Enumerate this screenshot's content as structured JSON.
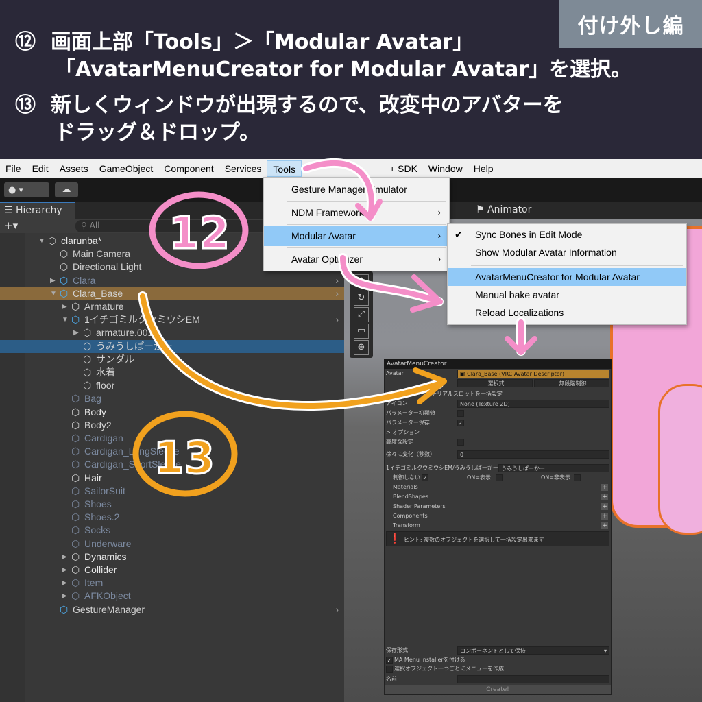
{
  "banner": {
    "badge": "付け外し編",
    "step12": {
      "num": "⑫",
      "line1": "画面上部「Tools」＞「Modular Avatar」",
      "line2": "「AvatarMenuCreator for Modular Avatar」を選択。"
    },
    "step13": {
      "num": "⑬",
      "line1": "新しくウィンドウが出現するので、改変中のアバターを",
      "line2": "ドラッグ＆ドロップ。"
    }
  },
  "menubar": [
    "File",
    "Edit",
    "Assets",
    "GameObject",
    "Component",
    "Services",
    "Tools",
    "",
    "+ SDK",
    "Window",
    "Help"
  ],
  "tools_menu": [
    "Gesture Manager Emulator",
    "NDM Framework",
    "Modular Avatar",
    "Avatar Optimizer"
  ],
  "ma_submenu": [
    "Sync Bones in Edit Mode",
    "Show Modular Avatar Information",
    "AvatarMenuCreator for Modular Avatar",
    "Manual bake avatar",
    "Reload Localizations"
  ],
  "hierarchy": {
    "tab": "Hierarchy",
    "search_placeholder": "All",
    "rows": [
      "clarunba*",
      "Main Camera",
      "Directional Light",
      "Clara",
      "Clara_Base",
      "Armature",
      "1イチゴミルクウミウシEM",
      "armature.001",
      "うみうしぱーかー",
      "サンダル",
      "水着",
      "floor",
      "Bag",
      "Body",
      "Body2",
      "Cardigan",
      "Cardigan_LongSleeve",
      "Cardigan_ShortSleeve",
      "Hair",
      "SailorSuit",
      "Shoes",
      "Shoes.2",
      "Socks",
      "Underware",
      "Dynamics",
      "Collider",
      "Item",
      "AFKObject",
      "GestureManager"
    ]
  },
  "scene": {
    "animator_tab": "Animator"
  },
  "amc": {
    "title": "AvatarMenuCreator",
    "avatar_label": "Avatar",
    "avatar_value": "Clara_Base (VRC Avatar Descriptor)",
    "mode_select": "選択式",
    "mode_unlimited": "無段階制御",
    "material_slot": "マテリアルスロットを一括設定",
    "icon_label": "アイコン",
    "icon_value": "None (Texture 2D)",
    "param_default": "パラメーター初期値",
    "param_saved": "パラメーター保存",
    "option": "> オプション",
    "advanced": "高度な設定",
    "fade_label": "徐々に変化（秒数）",
    "fade_value": "0",
    "object_path": "1イチゴミルクウミウシEM/うみうしぱーかー",
    "object_field": "うみうしぱーかー",
    "no_control": "制御しない",
    "on_show": "ON=表示",
    "on_hide": "ON=非表示",
    "sections": [
      "Materials",
      "BlendShapes",
      "Shader Parameters",
      "Components",
      "Transform"
    ],
    "hint": "ヒント: 複数のオブジェクトを選択して一括設定出来ます",
    "save_format_label": "保存形式",
    "save_format_value": "コンポーネントとして保持",
    "ma_installer": "MA Menu Installerを付ける",
    "per_object_menu": "選択オブジェクト一つごとにメニューを作成",
    "name_label": "名前",
    "create": "Create!"
  },
  "annotations": {
    "c12": "12",
    "c13": "13"
  },
  "colors": {
    "pink": "#f48ec8",
    "orange": "#f1a11e",
    "banner": "#2a2838",
    "badge": "#7e8a96"
  }
}
